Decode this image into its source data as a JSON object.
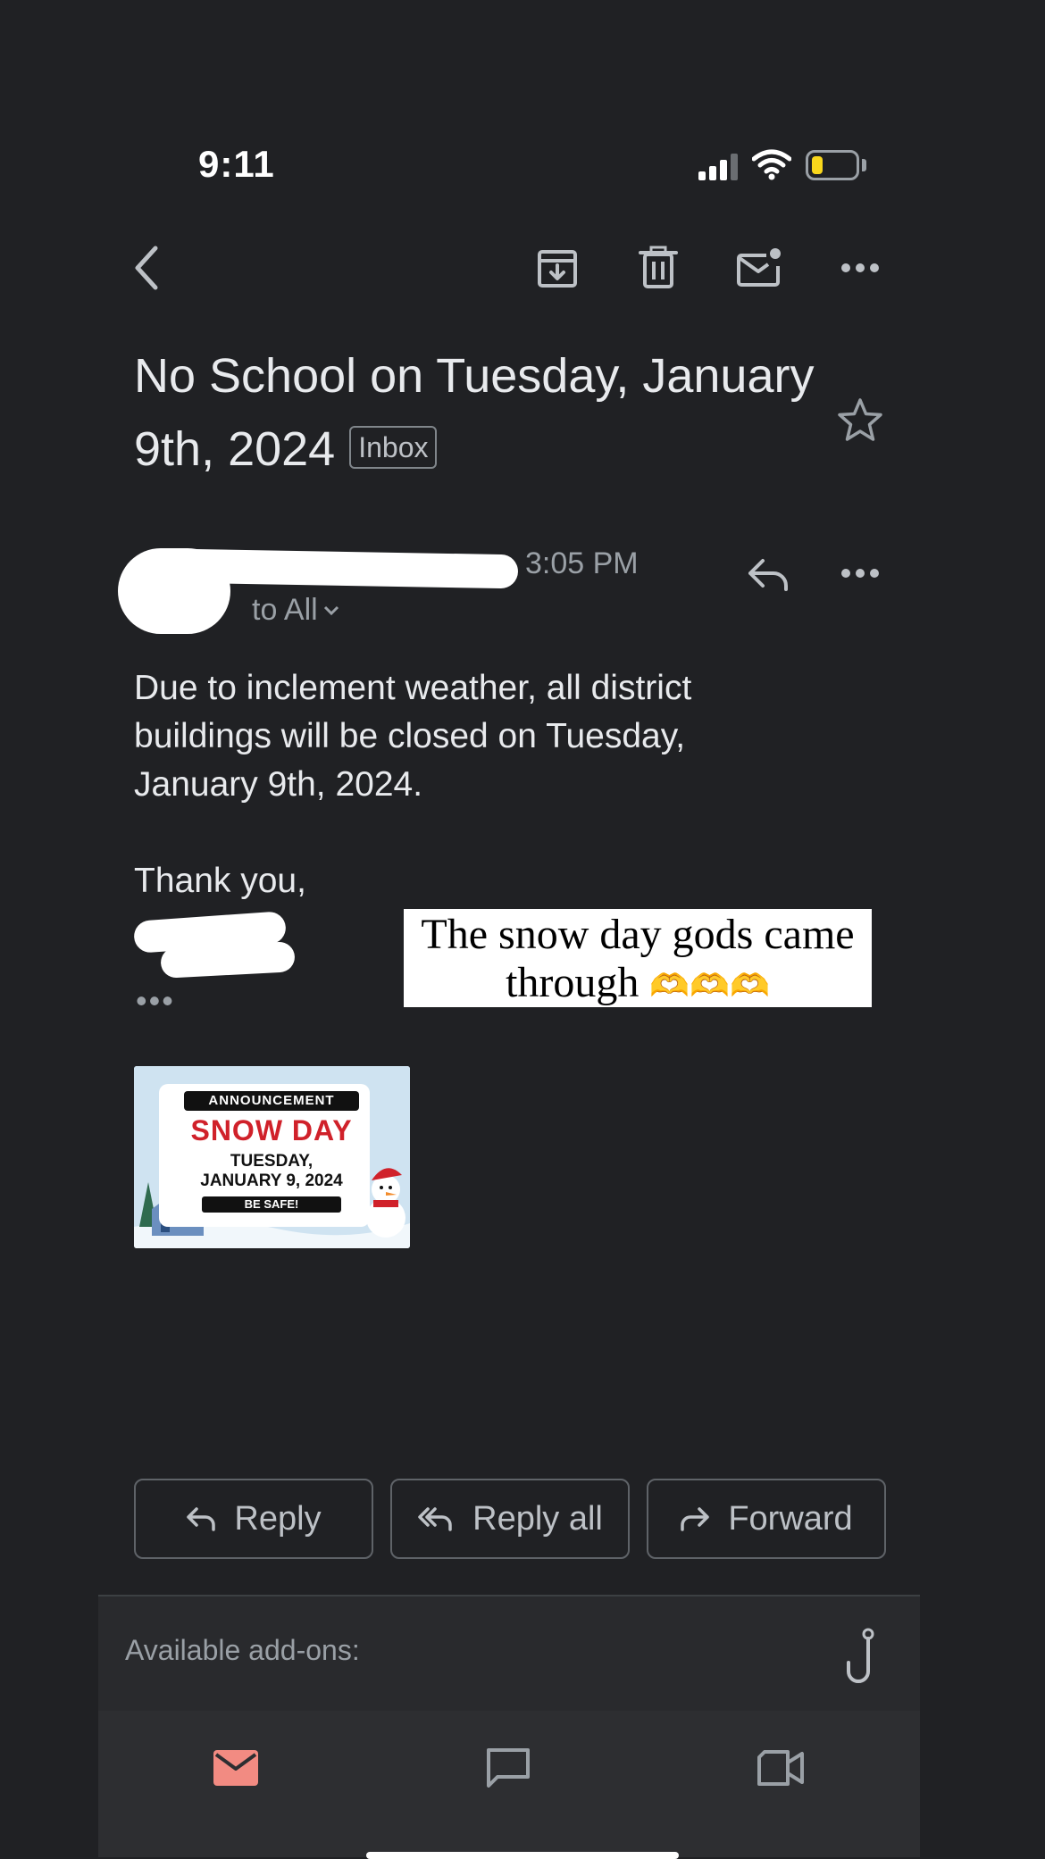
{
  "status_bar": {
    "time": "9:11"
  },
  "toolbar": {
    "back": "back-arrow-icon",
    "archive": "archive-icon",
    "delete": "trash-icon",
    "mark_unread": "mail-unread-icon",
    "more": "more-horizontal-icon"
  },
  "email": {
    "subject": "No School on Tuesday, January 9th, 2024",
    "label": "Inbox",
    "time": "3:05 PM",
    "recipients": "to All",
    "body_lines": [
      "Due to inclement weather, all district",
      "buildings will be closed on Tuesday,",
      "January 9th, 2024."
    ],
    "signoff": "Thank you,",
    "trimmed": "•••"
  },
  "overlay_caption": {
    "line1": "The snow day gods came",
    "line2": "through",
    "emoji": "🫶🫶🫶"
  },
  "attachment": {
    "announcement": "ANNOUNCEMENT",
    "headline": "SNOW DAY",
    "date_line1": "TUESDAY,",
    "date_line2": "JANUARY 9, 2024",
    "tagline": "BE SAFE!"
  },
  "actions": {
    "reply": "Reply",
    "reply_all": "Reply all",
    "forward": "Forward"
  },
  "addons": {
    "label": "Available add-ons:"
  },
  "colors": {
    "background": "#202124",
    "text": "#e8eaed",
    "muted": "#9aa0a6",
    "mail_active": "#f28b82",
    "snow_day_red": "#d0212a"
  }
}
